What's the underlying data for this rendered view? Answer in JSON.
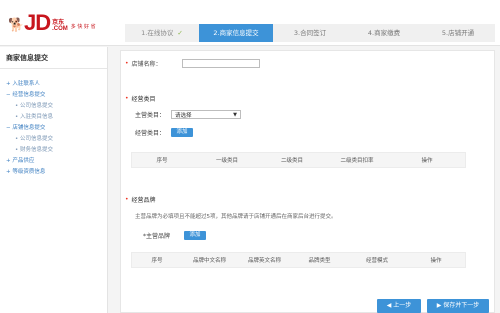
{
  "header": {
    "logo_text": "JD",
    "logo_sub_top": "京东",
    "logo_sub_bottom": ".COM",
    "slogan": "多 快 好 省"
  },
  "steps": [
    {
      "label": "1.在线协议",
      "mark": "✓",
      "state": "done"
    },
    {
      "label": "2.商家信息提交",
      "mark": "",
      "state": "active"
    },
    {
      "label": "3.合同签订",
      "mark": "",
      "state": "pending"
    },
    {
      "label": "4.商家缴费",
      "mark": "",
      "state": "pending"
    },
    {
      "label": "5.店铺开通",
      "mark": "",
      "state": "pending"
    }
  ],
  "sidebar": {
    "title": "商家信息提交",
    "items": [
      {
        "label": "+ 入驻联系人",
        "level": 0
      },
      {
        "label": "− 经营信息提交",
        "level": 0
      },
      {
        "label": "• 公司信息提交",
        "level": 1
      },
      {
        "label": "• 入驻类目信息",
        "level": 1
      },
      {
        "label": "− 店铺信息提交",
        "level": 0
      },
      {
        "label": "• 公司信息提交",
        "level": 1
      },
      {
        "label": "• 财务信息提交",
        "level": 1
      },
      {
        "label": "+ 产品供应",
        "level": 0
      },
      {
        "label": "+ 等级资质信息",
        "level": 0
      }
    ]
  },
  "main": {
    "store_name_label": "店铺名称：",
    "store_name_value": "",
    "category_section": "经营类目",
    "main_category_label": "主营类目：",
    "main_category_value": "请选择",
    "business_category_label": "经营类目：",
    "add_label": "添加",
    "category_table_headers": [
      "序号",
      "一级类目",
      "二级类目",
      "二级类目扣率",
      "操作"
    ],
    "brand_section": "经营品牌",
    "brand_note": "主营品牌为必填项且不能超过5项，其他品牌请于店铺开通后在商家后台进行提交。",
    "main_brand_label": "*主营品牌",
    "brand_add_label": "添加",
    "brand_table_headers": [
      "序号",
      "品牌中文名称",
      "品牌英文名称",
      "品牌类型",
      "经营模式",
      "操作"
    ]
  },
  "footer": {
    "prev_label": "上一步",
    "next_label": "保存并下一步"
  },
  "colors": {
    "accent": "#3d93d8",
    "brand_red": "#c8161d",
    "required_red": "#ee3322",
    "check_green": "#8bb64a"
  }
}
